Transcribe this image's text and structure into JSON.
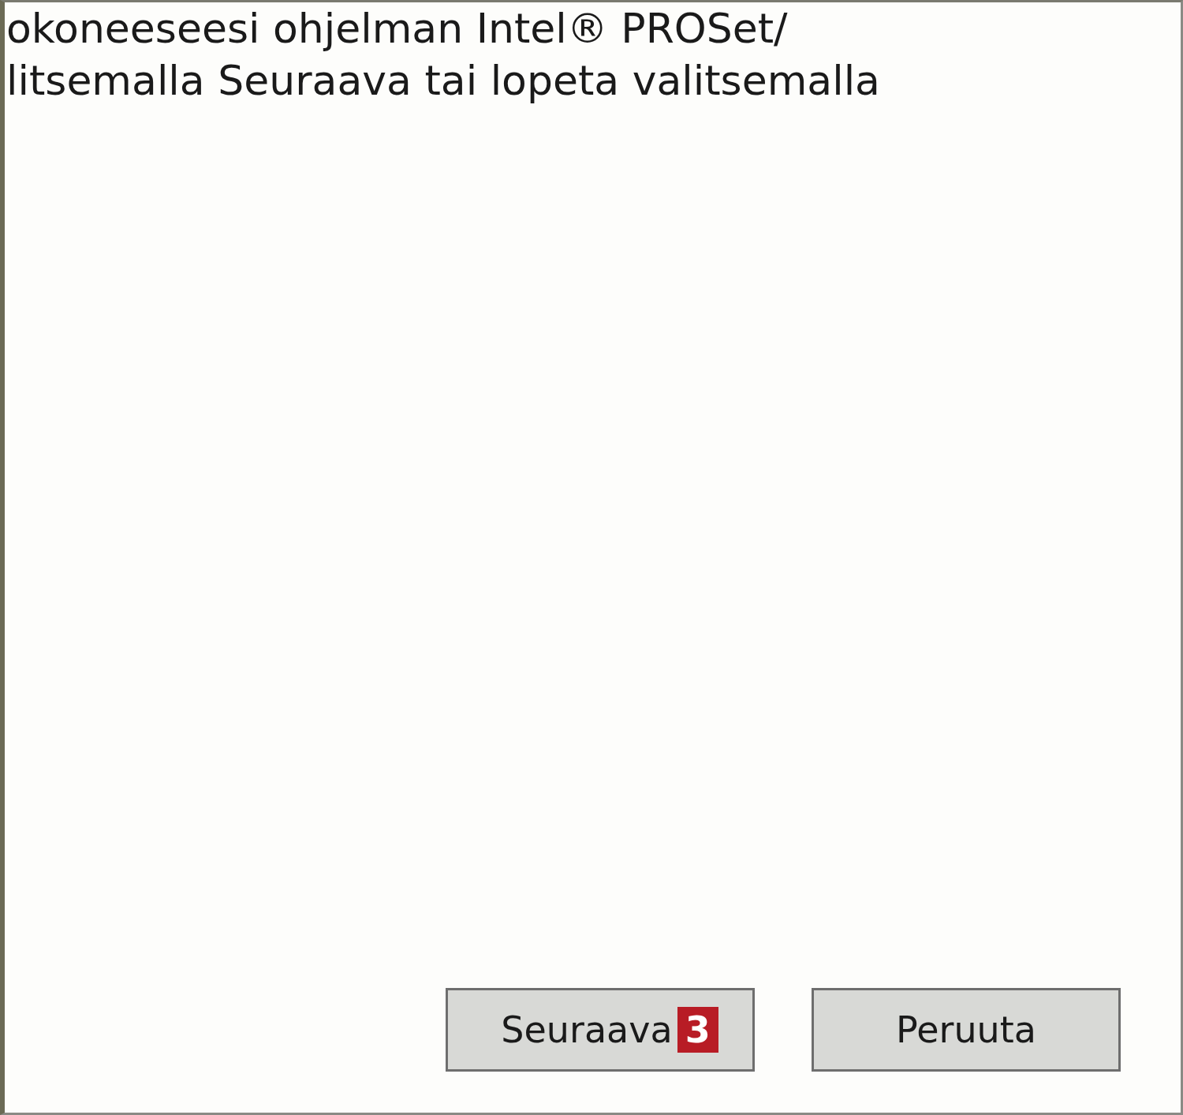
{
  "text_lines": [
    "okoneeseesi ohjelman Intel® PROSet/",
    "litsemalla Seuraava tai lopeta valitsemalla"
  ],
  "buttons": [
    {
      "label": "Seuraava",
      "badge": "3"
    },
    {
      "label": "Peruuta"
    }
  ]
}
